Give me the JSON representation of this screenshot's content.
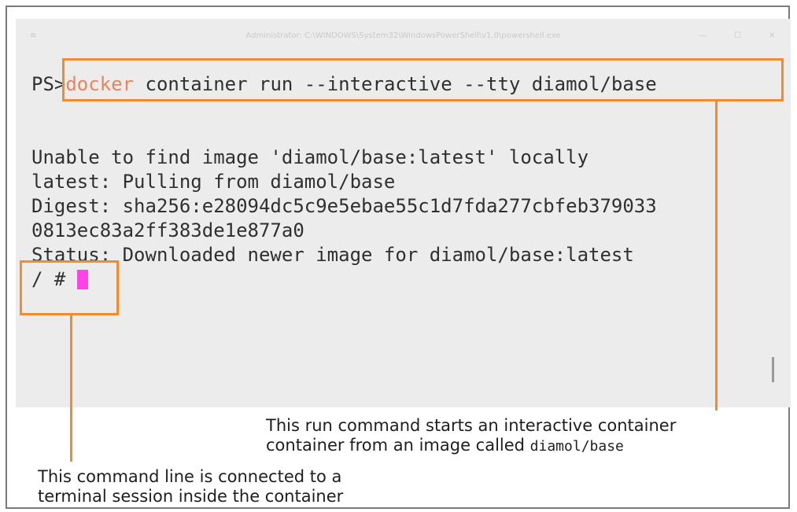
{
  "window": {
    "title": "Administrator: C:\\WINDOWS\\System32\\WindowsPowerShell\\v1.0\\powershell.exe",
    "menu_icon": "window-menu-icon",
    "controls": {
      "minimize": "—",
      "maximize": "☐",
      "close": "✕"
    }
  },
  "terminal": {
    "prompt": "PS",
    "prompt_marker": ">",
    "command_keyword": "docker",
    "command_rest": " container run --interactive --tty diamol/base",
    "output_lines": [
      "Unable to find image 'diamol/base:latest' locally",
      "latest: Pulling from diamol/base",
      "Digest: sha256:e28094dc5c9e5ebae55c1d7fda277cbfeb379033",
      "0813ec83a2ff383de1e877a0",
      "Status: Downloaded newer image for diamol/base:latest"
    ],
    "shell_prompt": "/ # "
  },
  "annotations": {
    "run_command": {
      "line1": "This run command starts an interactive container",
      "line2_prefix": "container from an image called ",
      "line2_code": "diamol/base"
    },
    "command_line": {
      "line1": "This command line is connected to a",
      "line2": "terminal session inside the container"
    }
  },
  "colors": {
    "highlight": "#f28a30",
    "command_keyword": "#e8845e",
    "cursor": "#ff43e6",
    "terminal_background": "#ececec",
    "terminal_text": "#303030"
  }
}
